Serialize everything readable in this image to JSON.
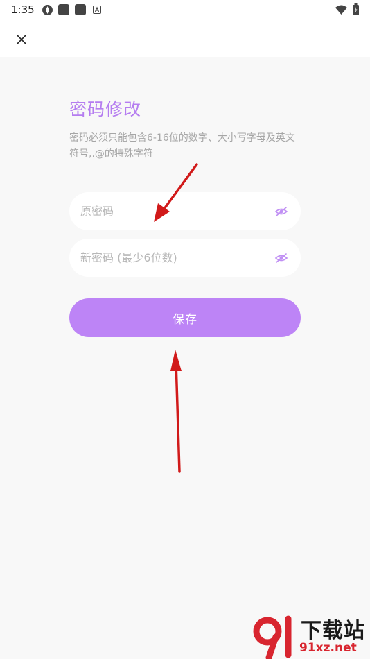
{
  "status_bar": {
    "time": "1:35",
    "icons": [
      "hotspot-icon",
      "app-icon",
      "app-icon",
      "font-icon",
      "wifi-icon",
      "battery-icon"
    ]
  },
  "toolbar": {
    "close_icon": "close-icon"
  },
  "page": {
    "title": "密码修改",
    "hint": "密码必须只能包含6-16位的数字、大小写字母及英文符号,.@的特殊字符"
  },
  "form": {
    "old_password": {
      "value": "",
      "placeholder": "原密码",
      "icon": "eye-off-icon"
    },
    "new_password": {
      "value": "",
      "placeholder": "新密码 (最少6位数)",
      "icon": "eye-off-icon"
    },
    "save_label": "保存"
  },
  "watermark": {
    "title": "下载站",
    "url": "91xz.net"
  },
  "colors": {
    "accent": "#b57df0",
    "button": "#bd84f6",
    "background": "#f8f8f8",
    "annotation_arrow": "#d11a1a"
  }
}
